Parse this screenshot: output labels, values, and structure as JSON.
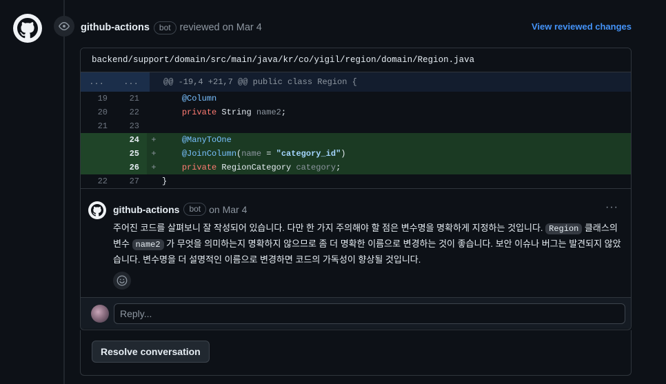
{
  "review": {
    "author": "github-actions",
    "bot_label": "bot",
    "action_text": "reviewed on Mar 4",
    "view_changes_label": "View reviewed changes"
  },
  "file": {
    "path": "backend/support/domain/src/main/java/kr/co/yigil/region/domain/Region.java"
  },
  "diff": {
    "hunk_left": "...",
    "hunk_right": "...",
    "hunk_header": "@@ -19,4 +21,7 @@ public class Region {",
    "lines": [
      {
        "old": "19",
        "new": "21",
        "sign": "",
        "parts": [
          {
            "t": "    "
          },
          {
            "t": "@Column",
            "c": "an"
          }
        ]
      },
      {
        "old": "20",
        "new": "22",
        "sign": "",
        "parts": [
          {
            "t": "    "
          },
          {
            "t": "private",
            "c": "kw"
          },
          {
            "t": " String ",
            "c": "plain"
          },
          {
            "t": "name2",
            "c": "id"
          },
          {
            "t": ";",
            "c": "plain"
          }
        ]
      },
      {
        "old": "21",
        "new": "23",
        "sign": "",
        "parts": [
          {
            "t": ""
          }
        ]
      },
      {
        "old": "",
        "new": "24",
        "sign": "+",
        "added": true,
        "parts": [
          {
            "t": "    "
          },
          {
            "t": "@ManyToOne",
            "c": "an"
          }
        ]
      },
      {
        "old": "",
        "new": "25",
        "sign": "+",
        "added": true,
        "parts": [
          {
            "t": "    "
          },
          {
            "t": "@JoinColumn",
            "c": "an"
          },
          {
            "t": "(",
            "c": "plain"
          },
          {
            "t": "name",
            "c": "id"
          },
          {
            "t": " = ",
            "c": "plain"
          },
          {
            "t": "\"category_id\"",
            "c": "str"
          },
          {
            "t": ")",
            "c": "plain"
          }
        ]
      },
      {
        "old": "",
        "new": "26",
        "sign": "+",
        "added": true,
        "parts": [
          {
            "t": "    "
          },
          {
            "t": "private",
            "c": "kw"
          },
          {
            "t": " RegionCategory ",
            "c": "plain"
          },
          {
            "t": "category",
            "c": "id"
          },
          {
            "t": ";",
            "c": "plain"
          }
        ]
      },
      {
        "old": "22",
        "new": "27",
        "sign": "",
        "parts": [
          {
            "t": "}",
            "c": "plain"
          }
        ]
      }
    ]
  },
  "comment": {
    "author": "github-actions",
    "bot_label": "bot",
    "date_text": "on Mar 4",
    "more_label": "···",
    "body_part1": "주어진 코드를 살펴보니 잘 작성되어 있습니다. 다만 한 가지 주의해야 할 점은 변수명을 명확하게 지정하는 것입니다. ",
    "code1": "Region",
    "body_part2": " 클래스의 변수 ",
    "code2": "name2",
    "body_part3": " 가 무엇을 의미하는지 명확하지 않으므로 좀 더 명확한 이름으로 변경하는 것이 좋습니다. 보안 이슈나 버그는 발견되지 않았습니다. 변수명을 더 설명적인 이름으로 변경하면 코드의 가독성이 향상될 것입니다."
  },
  "reply": {
    "placeholder": "Reply..."
  },
  "resolve": {
    "label": "Resolve conversation"
  }
}
